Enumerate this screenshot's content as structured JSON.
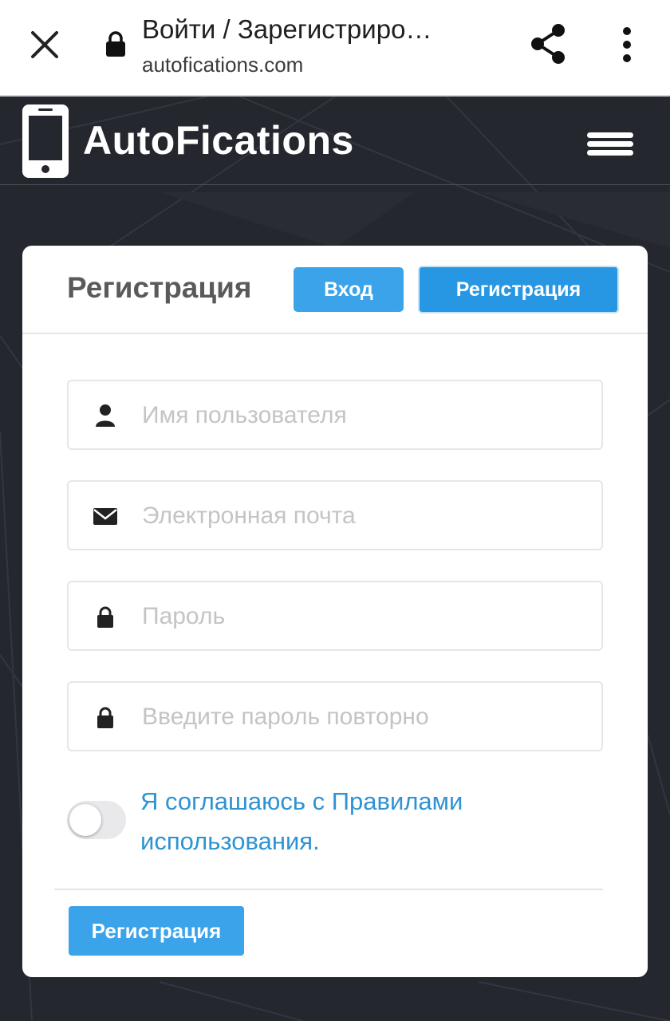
{
  "browser": {
    "tab_title": "Войти / Зарегистриро…",
    "url": "autofications.com",
    "close_icon": "close-icon",
    "secure_icon": "lock-icon",
    "share_icon": "share-icon",
    "more_icon": "more-vert-icon"
  },
  "site": {
    "brand": "AutoFications",
    "logo_icon": "phone-icon",
    "menu_icon": "hamburger-icon"
  },
  "card": {
    "title": "Регистрация",
    "tabs": {
      "login_label": "Вход",
      "register_label": "Регистрация"
    },
    "fields": {
      "username": {
        "placeholder": "Имя пользователя",
        "value": "",
        "icon": "user-icon"
      },
      "email": {
        "placeholder": "Электронная почта",
        "value": "",
        "icon": "envelope-icon"
      },
      "password": {
        "placeholder": "Пароль",
        "value": "",
        "icon": "lock-icon"
      },
      "password_repeat": {
        "placeholder": "Введите пароль повторно",
        "value": "",
        "icon": "lock-icon"
      }
    },
    "terms": {
      "text": "Я соглашаюсь с Правилами использования.",
      "checked": false
    },
    "submit_label": "Регистрация"
  },
  "colors": {
    "accent": "#3aa3ea",
    "accent_active": "#2797e4",
    "link": "#2e93d4",
    "background": "#24272e"
  }
}
